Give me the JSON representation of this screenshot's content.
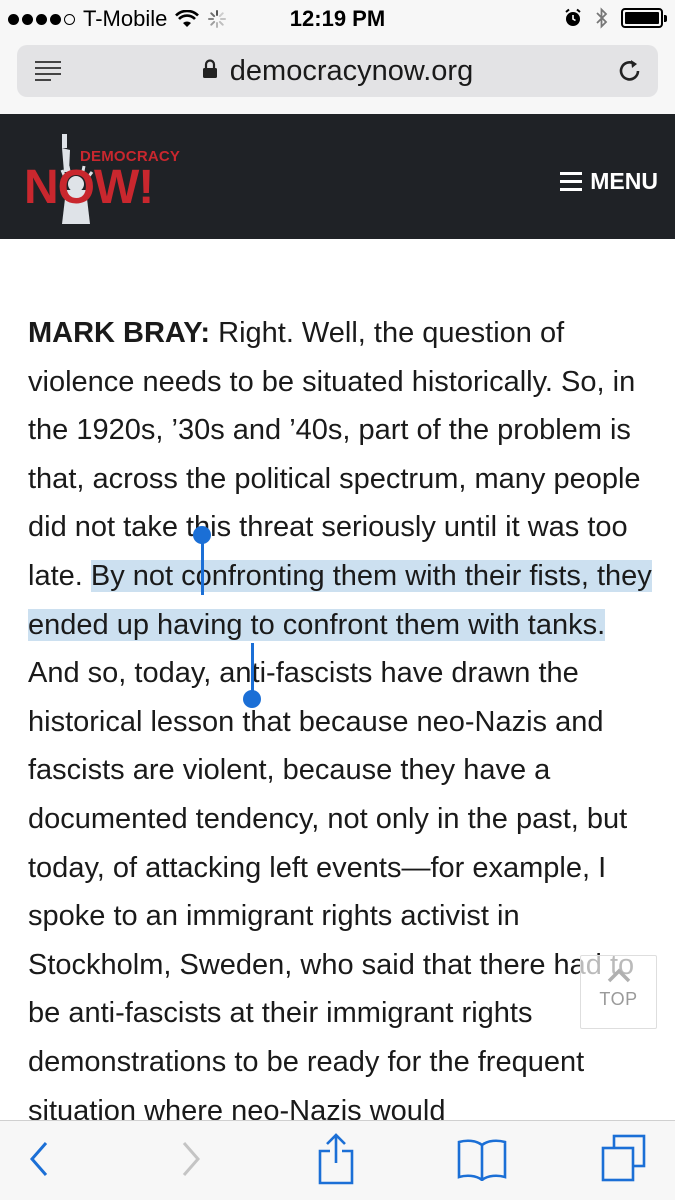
{
  "status_bar": {
    "carrier": "T-Mobile",
    "time": "12:19 PM"
  },
  "browser": {
    "url": "democracynow.org"
  },
  "site": {
    "logo_top": "DEMOCRACY",
    "logo_bottom": "NOW!",
    "menu_label": "MENU"
  },
  "article": {
    "speaker": "MARK BRAY:",
    "text_before_selection": " Right. Well, the question of violence needs to be situated historically. So, in the 1920s, ’30s and ’40s, part of the problem is that, across the political spectrum, many people did not take this threat seriously until it was too late. ",
    "selected_text": "By not confronting them with their fists, they ended up having to confront them with tanks.",
    "text_after_selection": " And so, today, anti-fascists have drawn the historical lesson that because neo-Nazis and fascists are violent, because they have a documented tendency, not only in the past, but today, of attacking left events—for example, I spoke to an immigrant rights activist in Stockholm, Sweden, who said that there had to be anti-fascists at their immigrant rights demonstrations to be ready for the frequent situation where neo-Nazis would"
  },
  "back_to_top": {
    "label": "TOP"
  },
  "toolbar": {
    "icons": [
      "back-icon",
      "forward-icon",
      "share-icon",
      "bookmarks-icon",
      "tabs-icon"
    ]
  },
  "colors": {
    "header_bg": "#1f2226",
    "brand_red": "#c9272e",
    "selection": "#cce0f0",
    "ios_blue": "#1b6fd6"
  }
}
